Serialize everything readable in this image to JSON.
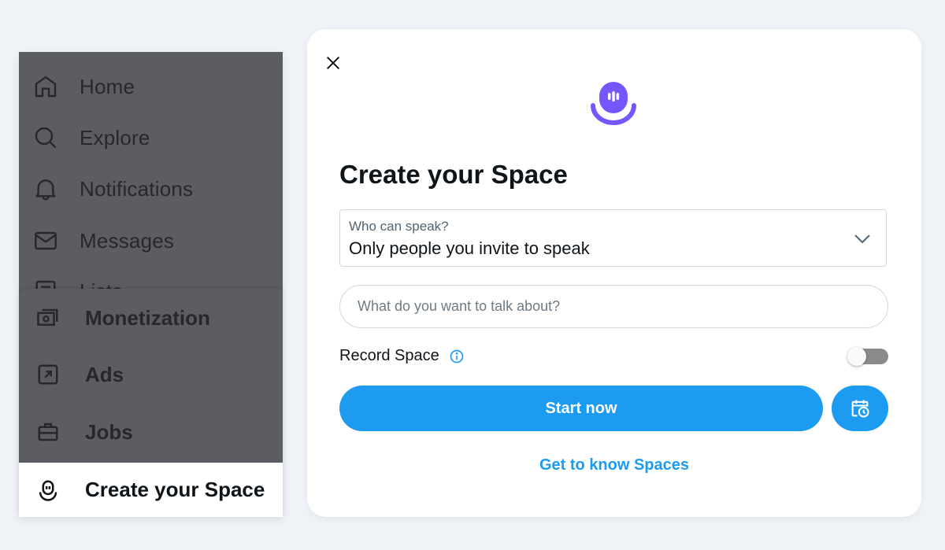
{
  "sidebar": {
    "items": [
      {
        "label": "Home",
        "icon": "home-icon"
      },
      {
        "label": "Explore",
        "icon": "search-icon"
      },
      {
        "label": "Notifications",
        "icon": "bell-icon"
      },
      {
        "label": "Messages",
        "icon": "envelope-icon"
      },
      {
        "label": "Lists",
        "icon": "list-icon"
      }
    ]
  },
  "more_menu": {
    "items": [
      {
        "label": "Monetization",
        "icon": "money-icon"
      },
      {
        "label": "Ads",
        "icon": "ads-arrow-icon"
      },
      {
        "label": "Jobs",
        "icon": "briefcase-icon"
      },
      {
        "label": "Create your Space",
        "icon": "spaces-icon",
        "active": true
      }
    ]
  },
  "modal": {
    "title": "Create your Space",
    "speaker_select": {
      "label": "Who can speak?",
      "value": "Only people you invite to speak"
    },
    "topic_input": {
      "value": "",
      "placeholder": "What do you want to talk about?"
    },
    "record": {
      "label": "Record Space",
      "enabled": false
    },
    "start_button": "Start now",
    "schedule_button_icon": "calendar-clock-icon",
    "learn_link": "Get to know Spaces"
  },
  "colors": {
    "accent": "#1d9bf0",
    "spaces_purple": "#7856ff",
    "overlay": "#5b5d62",
    "background": "#eff3f7"
  }
}
